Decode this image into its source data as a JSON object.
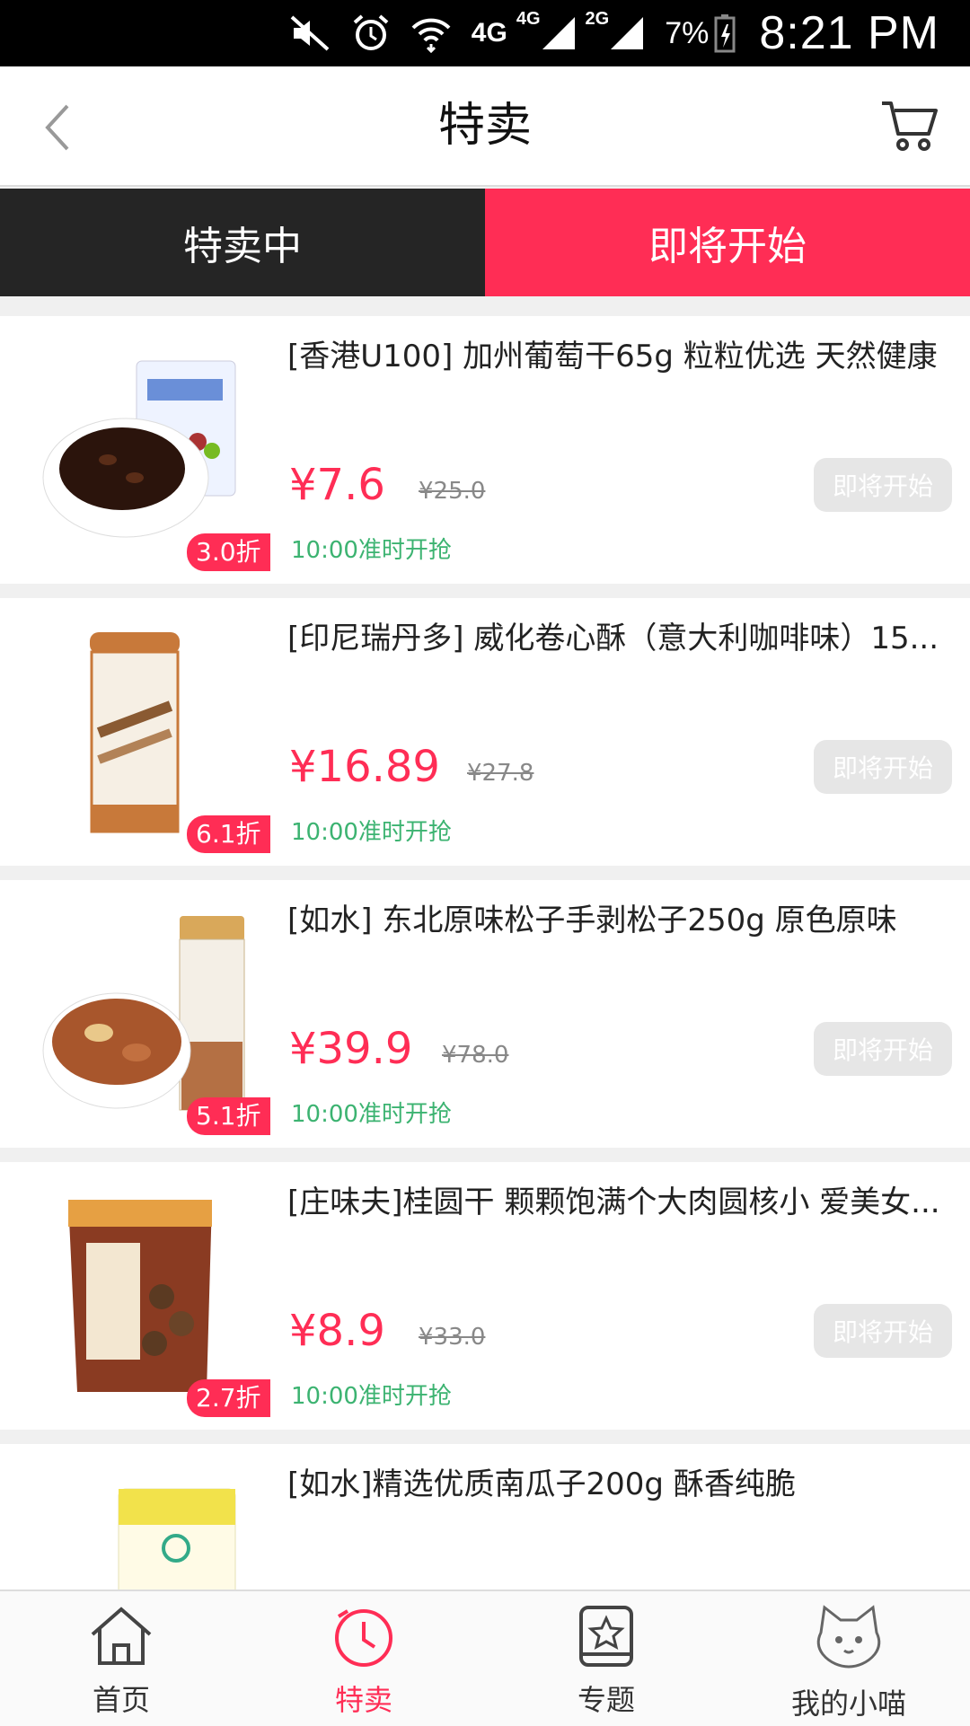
{
  "status_bar": {
    "network_1": "4G",
    "network_2": "4G",
    "network_3": "2G",
    "battery": "7%",
    "time": "8:21 PM"
  },
  "header": {
    "title": "特卖",
    "back_icon": "chevron-left-icon",
    "cart_icon": "cart-icon"
  },
  "tabs": [
    {
      "label": "特卖中",
      "active": false
    },
    {
      "label": "即将开始",
      "active": true
    }
  ],
  "products": [
    {
      "title": "[香港U100] 加州葡萄干65g 粒粒优选 天然健康",
      "price": "¥7.6",
      "original": "¥25.0",
      "discount": "3.0折",
      "start": "10:00准时开抢",
      "button": "即将开始"
    },
    {
      "title": "[印尼瑞丹多] 威化卷心酥（意大利咖啡味）15...",
      "price": "¥16.89",
      "original": "¥27.8",
      "discount": "6.1折",
      "start": "10:00准时开抢",
      "button": "即将开始"
    },
    {
      "title": "[如水] 东北原味松子手剥松子250g  原色原味",
      "price": "¥39.9",
      "original": "¥78.0",
      "discount": "5.1折",
      "start": "10:00准时开抢",
      "button": "即将开始"
    },
    {
      "title": "[庄味夫]桂圆干 颗颗饱满个大肉圆核小 爱美女...",
      "price": "¥8.9",
      "original": "¥33.0",
      "discount": "2.7折",
      "start": "10:00准时开抢",
      "button": "即将开始"
    },
    {
      "title": "[如水]精选优质南瓜子200g 酥香纯脆"
    }
  ],
  "bottom_nav": [
    {
      "label": "首页",
      "icon": "home-icon"
    },
    {
      "label": "特卖",
      "icon": "clock-icon",
      "active": true
    },
    {
      "label": "专题",
      "icon": "star-tablet-icon"
    },
    {
      "label": "我的小喵",
      "icon": "cat-icon"
    }
  ],
  "colors": {
    "accent": "#ff2d55",
    "dark_tab": "#252525",
    "start_text": "#3cb371"
  }
}
